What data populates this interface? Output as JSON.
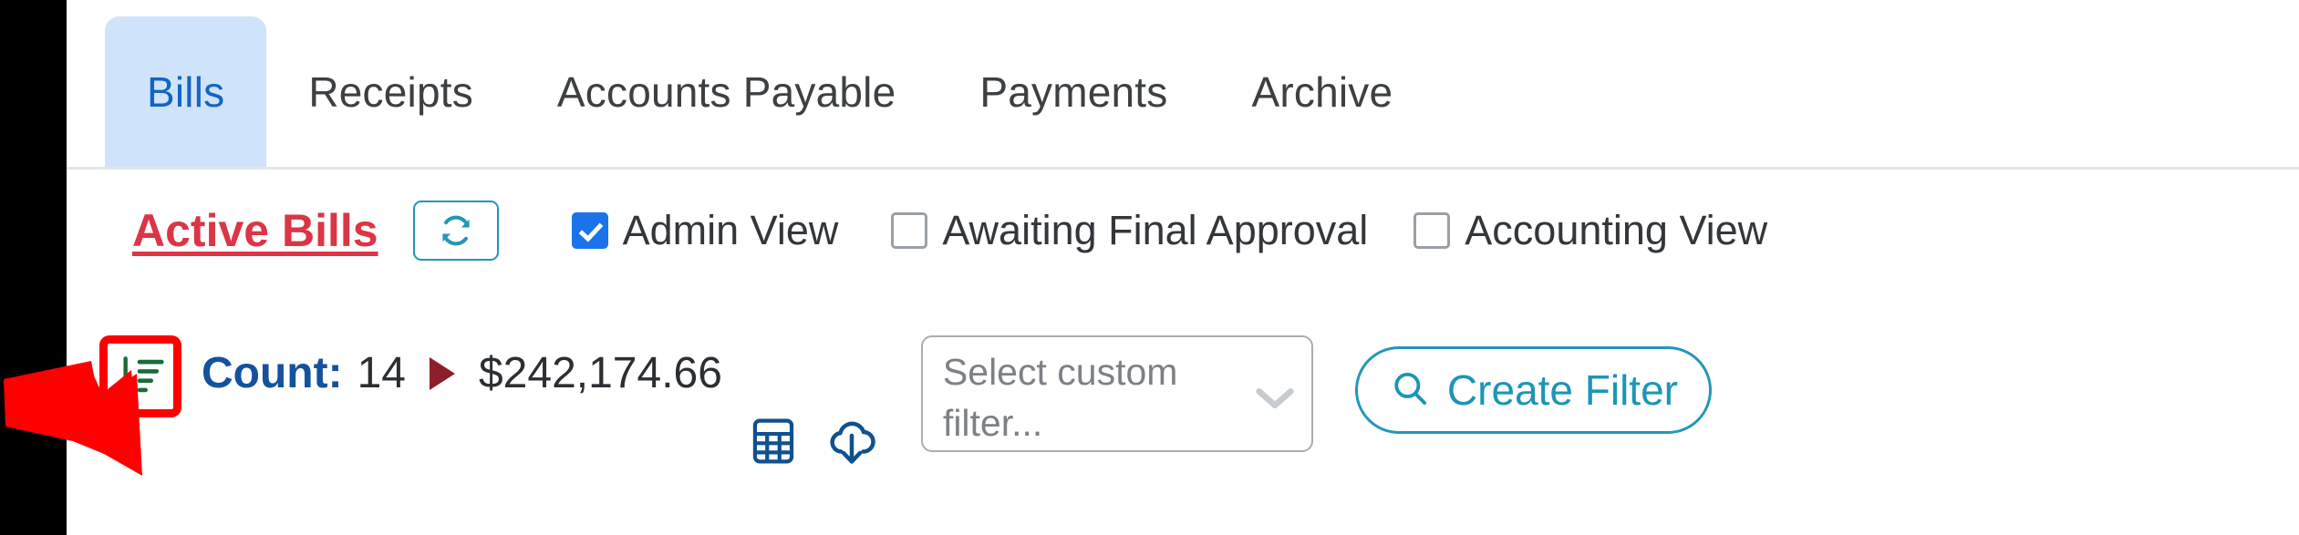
{
  "tabs": [
    {
      "label": "Bills",
      "active": true
    },
    {
      "label": "Receipts",
      "active": false
    },
    {
      "label": "Accounts Payable",
      "active": false
    },
    {
      "label": "Payments",
      "active": false
    },
    {
      "label": "Archive",
      "active": false
    }
  ],
  "header": {
    "title": "Active Bills",
    "refresh_icon": "refresh-icon",
    "checkboxes": [
      {
        "label": "Admin View",
        "checked": true
      },
      {
        "label": "Awaiting Final Approval",
        "checked": false
      },
      {
        "label": "Accounting View",
        "checked": false
      }
    ]
  },
  "toolbar": {
    "sort_icon": "sort-descending-icon",
    "count_label": "Count:",
    "count_value": "14",
    "expand_icon": "triangle-right-icon",
    "amount": "$242,174.66",
    "calculator_icon": "calculator-icon",
    "download_icon": "cloud-download-icon",
    "filter_select_placeholder": "Select custom filter...",
    "chevron_icon": "chevron-down-icon",
    "create_filter_label": "Create Filter",
    "search_icon": "search-icon"
  },
  "annotation": {
    "arrow_icon": "red-pointer-arrow",
    "highlight_color": "#ff0000",
    "target": "sort-descending-icon"
  },
  "colors": {
    "active_tab_bg": "#cfe4fa",
    "active_tab_text": "#1463c6",
    "title_red": "#dc3545",
    "teal": "#2397b8",
    "blue_accent": "#14529e",
    "checkbox_blue": "#1a73e8",
    "sort_green": "#1a6b35",
    "triangle_dark_red": "#8c1f2a"
  }
}
